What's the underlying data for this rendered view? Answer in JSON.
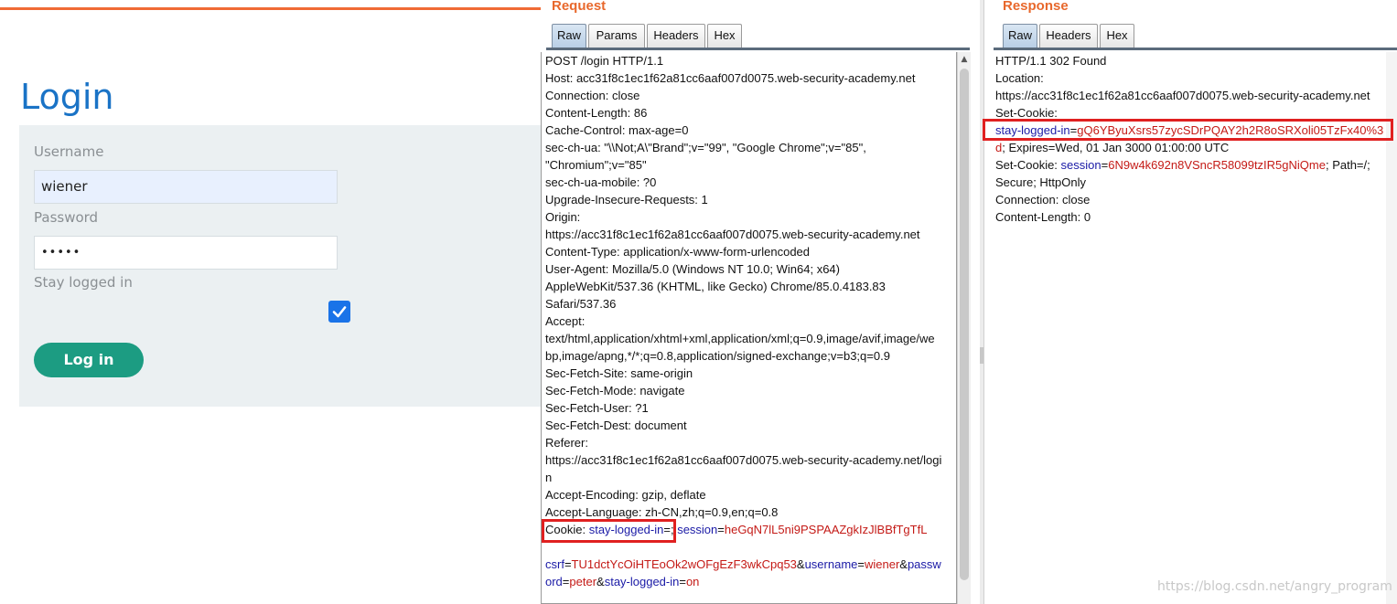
{
  "login": {
    "title": "Login",
    "username_label": "Username",
    "username_value": "wiener",
    "password_label": "Password",
    "password_value": "•••••",
    "stay_label": "Stay logged in",
    "stay_checked": true,
    "button_label": "Log in"
  },
  "request": {
    "title": "Request",
    "tabs": [
      "Raw",
      "Params",
      "Headers",
      "Hex"
    ],
    "lines": [
      "POST /login HTTP/1.1",
      "Host: acc31f8c1ec1f62a81cc6aaf007d0075.web-security-academy.net",
      "Connection: close",
      "Content-Length: 86",
      "Cache-Control: max-age=0",
      "sec-ch-ua: \"\\\\Not;A\\\"Brand\";v=\"99\", \"Google Chrome\";v=\"85\",",
      "\"Chromium\";v=\"85\"",
      "sec-ch-ua-mobile: ?0",
      "Upgrade-Insecure-Requests: 1",
      "Origin:",
      "https://acc31f8c1ec1f62a81cc6aaf007d0075.web-security-academy.net",
      "Content-Type: application/x-www-form-urlencoded",
      "User-Agent: Mozilla/5.0 (Windows NT 10.0; Win64; x64)",
      "AppleWebKit/537.36 (KHTML, like Gecko) Chrome/85.0.4183.83",
      "Safari/537.36",
      "Accept:",
      "text/html,application/xhtml+xml,application/xml;q=0.9,image/avif,image/we",
      "bp,image/apng,*/*;q=0.8,application/signed-exchange;v=b3;q=0.9",
      "Sec-Fetch-Site: same-origin",
      "Sec-Fetch-Mode: navigate",
      "Sec-Fetch-User: ?1",
      "Sec-Fetch-Dest: document",
      "Referer:",
      "https://acc31f8c1ec1f62a81cc6aaf007d0075.web-security-academy.net/logi",
      "n",
      "Accept-Encoding: gzip, deflate",
      "Accept-Language: zh-CN,zh;q=0.9,en;q=0.8"
    ],
    "cookie_line": {
      "prefix": "Cookie: ",
      "k1": "stay-logged-in",
      "eq1": "=; ",
      "k2": "session",
      "eq2": "=",
      "v2": "heGqN7lL5ni9PSPAAZgkIzJlBBfTgTfL"
    },
    "body_line1": {
      "k1": "csrf",
      "v1": "TU1dctYcOiHTEoOk2wOFgEzF3wkCpq53",
      "amp1": "&",
      "k2": "username",
      "v2": "wiener",
      "amp2": "&",
      "k3": "passw"
    },
    "body_line2": {
      "k3b": "ord",
      "v3": "peter",
      "amp3": "&",
      "k4": "stay-logged-in",
      "v4": "on"
    }
  },
  "response": {
    "title": "Response",
    "tabs": [
      "Raw",
      "Headers",
      "Hex"
    ],
    "lines_top": [
      "HTTP/1.1 302 Found",
      "Location:",
      "https://acc31f8c1ec1f62a81cc6aaf007d0075.web-security-academy.net",
      "Set-Cookie:"
    ],
    "cookie1": {
      "k": "stay-logged-in",
      "eq": "=",
      "v": "gQ6YByuXsrs57zycSDrPQAY2h2R8oSRXoli05TzFx40%3"
    },
    "cookie1_cont": {
      "v": "d",
      "rest": "; Expires=Wed, 01 Jan 3000 01:00:00 UTC"
    },
    "cookie2": {
      "prefix": "Set-Cookie: ",
      "k": "session",
      "eq": "=",
      "v": "6N9w4k692n8VSncR58099tzIR5gNiQme",
      "rest": "; Path=/;"
    },
    "lines_bottom": [
      "Secure; HttpOnly",
      "Connection: close",
      "Content-Length: 0"
    ]
  },
  "watermark": "https://blog.csdn.net/angry_program"
}
